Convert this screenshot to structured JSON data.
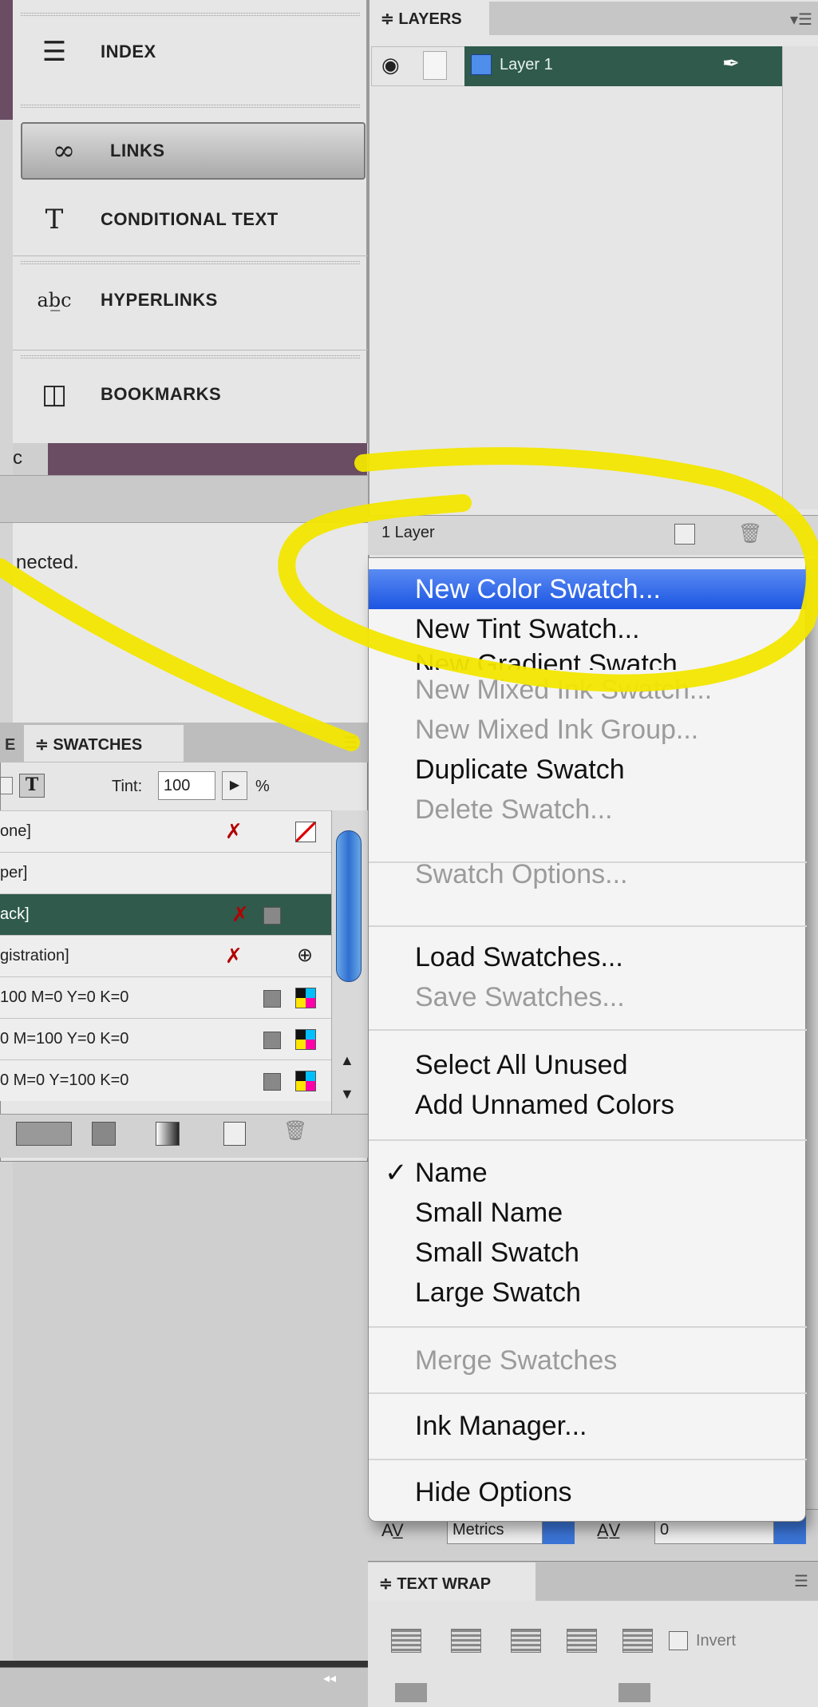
{
  "dock": {
    "items": [
      {
        "label": "INDEX",
        "icon": "index-icon"
      },
      {
        "label": "LINKS",
        "icon": "links-icon"
      },
      {
        "label": "CONDITIONAL TEXT",
        "icon": "conditional-text-icon"
      },
      {
        "label": "HYPERLINKS",
        "icon": "hyperlinks-icon"
      },
      {
        "label": "BOOKMARKS",
        "icon": "bookmarks-icon"
      }
    ],
    "hidden_fragment": "c",
    "status_fragment": "nected."
  },
  "layers": {
    "tab_label": "≑ LAYERS",
    "layer_name": "Layer 1",
    "layer_color": "#4f8eea",
    "count": "1 Layer"
  },
  "swatches": {
    "tab_prev": "E",
    "tab_label": "≑ SWATCHES",
    "tint_label": "Tint:",
    "tint_value": "100",
    "tint_unit": "%",
    "rows": [
      {
        "name": "one]"
      },
      {
        "name": "per]"
      },
      {
        "name": "ack]"
      },
      {
        "name": "gistration]"
      },
      {
        "name": "100 M=0 Y=0 K=0"
      },
      {
        "name": "0 M=100 Y=0 K=0"
      },
      {
        "name": "0 M=0 Y=100 K=0"
      }
    ]
  },
  "menu": {
    "items": [
      {
        "label": "New Color Swatch...",
        "state": "highlighted"
      },
      {
        "label": "New Tint Swatch...",
        "state": "enabled"
      },
      {
        "label": "New Gradient Swatch...",
        "state": "enabled"
      },
      {
        "label": "New Mixed Ink Swatch...",
        "state": "disabled"
      },
      {
        "label": "New Mixed Ink Group...",
        "state": "disabled"
      },
      {
        "label": "Duplicate Swatch",
        "state": "enabled"
      },
      {
        "label": "Delete Swatch...",
        "state": "disabled"
      },
      {
        "label": "Swatch Options...",
        "state": "disabled"
      },
      {
        "label": "Load Swatches...",
        "state": "enabled"
      },
      {
        "label": "Save Swatches...",
        "state": "disabled"
      },
      {
        "label": "Select All Unused",
        "state": "enabled"
      },
      {
        "label": "Add Unnamed Colors",
        "state": "enabled"
      },
      {
        "label": "Name",
        "state": "checked"
      },
      {
        "label": "Small Name",
        "state": "enabled"
      },
      {
        "label": "Small Swatch",
        "state": "enabled"
      },
      {
        "label": "Large Swatch",
        "state": "enabled"
      },
      {
        "label": "Merge Swatches",
        "state": "disabled"
      },
      {
        "label": "Ink Manager...",
        "state": "enabled"
      },
      {
        "label": "Hide Options",
        "state": "enabled"
      }
    ],
    "check_mark": "✓"
  },
  "character": {
    "kerning_value": "Metrics",
    "tracking_value": "0"
  },
  "text_wrap": {
    "tab_label": "≑ TEXT WRAP",
    "invert_label": "Invert"
  },
  "colors": {
    "highlight": "#1b55e2",
    "selection_green": "#2f5a4c",
    "annotation_yellow": "#f2e600"
  }
}
